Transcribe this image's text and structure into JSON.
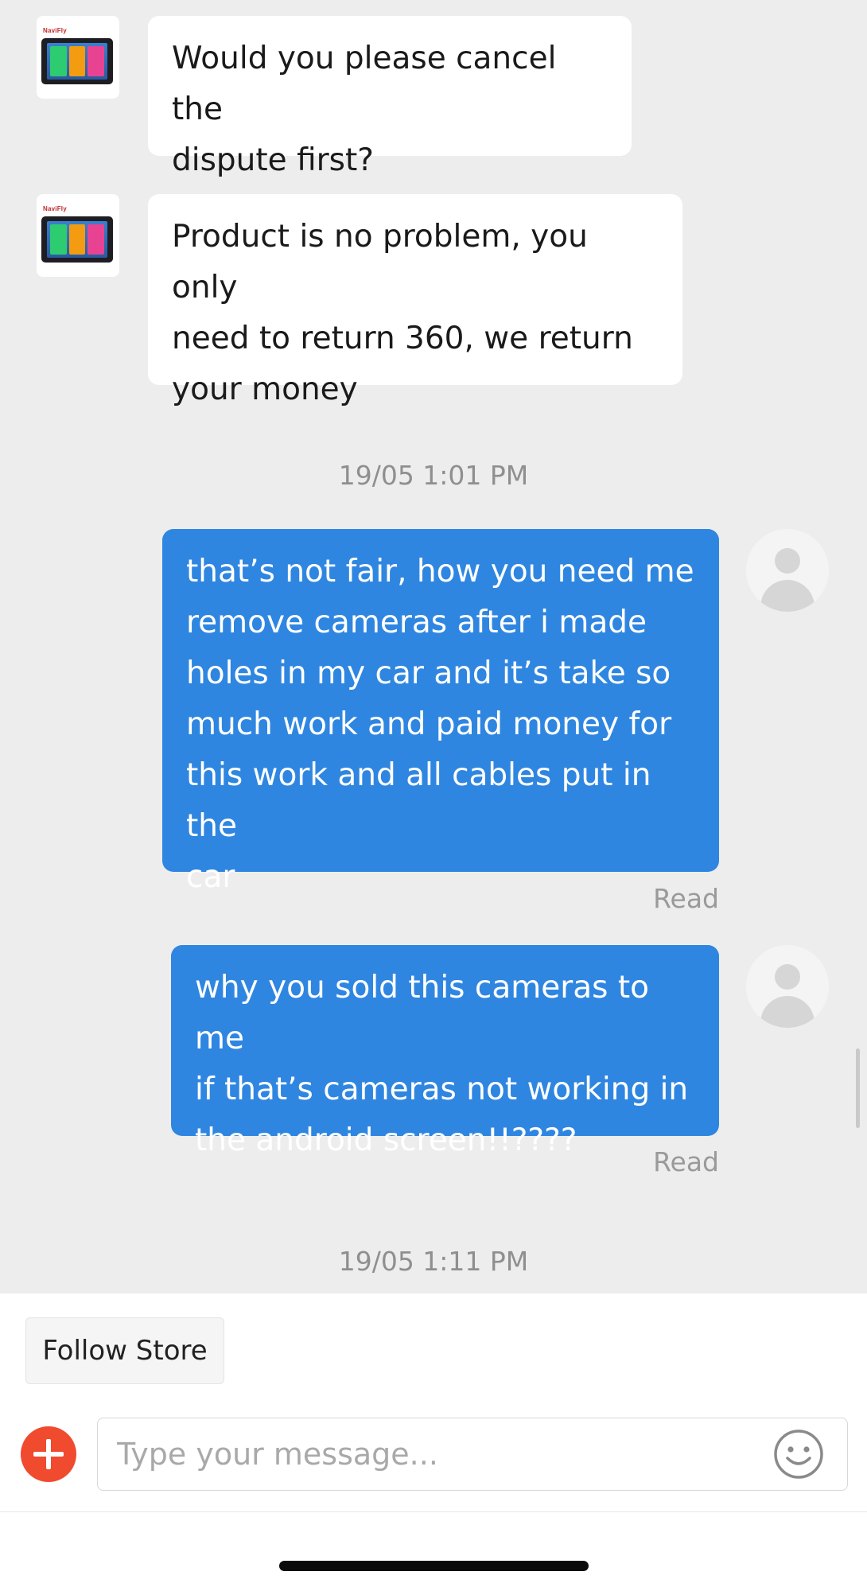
{
  "messages": [
    {
      "sender": "store",
      "text": "Would you please cancel the\ndispute first?"
    },
    {
      "sender": "store",
      "text": "Product is no problem, you only\nneed to return 360, we return\nyour money"
    },
    {
      "sender": "user",
      "text": "that’s not fair, how you need me\nremove cameras after i made\nholes in my car and it’s take so\nmuch work and paid money for\nthis work and all cables put in the\ncar",
      "status": "Read"
    },
    {
      "sender": "user",
      "text": "why you sold this cameras to me\nif that’s cameras not working in\nthe android screen!!????",
      "status": "Read"
    }
  ],
  "timestamps": [
    "19/05 1:01 PM",
    "19/05 1:11 PM"
  ],
  "store_avatar_brand": "NaviFly",
  "footer": {
    "follow_label": "Follow Store",
    "input_placeholder": "Type your message..."
  },
  "colors": {
    "chat_background": "#ededed",
    "outgoing_bubble": "#2f86e1",
    "incoming_bubble": "#ffffff",
    "add_button": "#f04a2f"
  },
  "icons": [
    "plus-icon",
    "smiley-icon",
    "user-avatar-icon"
  ]
}
